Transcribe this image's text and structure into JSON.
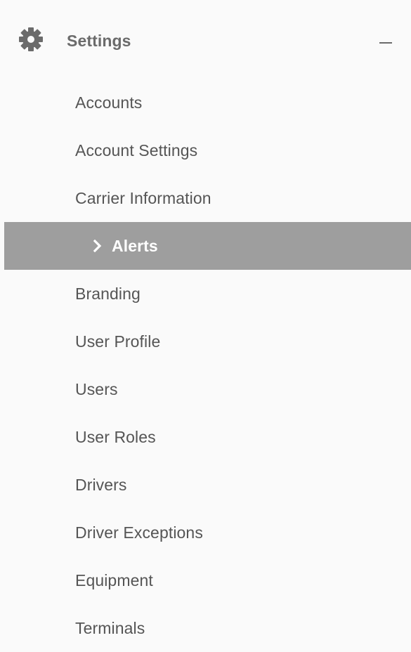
{
  "colors": {
    "background": "#fafafa",
    "header_text": "#6b6b6b",
    "item_text": "#555555",
    "active_background": "#9e9e9e",
    "active_text": "#ffffff"
  },
  "header": {
    "icon": "gear-icon",
    "label": "Settings",
    "toggle_icon": "minus-icon"
  },
  "menu": {
    "items": [
      {
        "label": "Accounts"
      },
      {
        "label": "Account Settings"
      },
      {
        "label": "Carrier Information"
      },
      {
        "label": "Alerts",
        "active": true,
        "icon": "chevron-right-icon"
      },
      {
        "label": "Branding"
      },
      {
        "label": "User Profile"
      },
      {
        "label": "Users"
      },
      {
        "label": "User Roles"
      },
      {
        "label": "Drivers"
      },
      {
        "label": "Driver Exceptions"
      },
      {
        "label": "Equipment"
      },
      {
        "label": "Terminals"
      }
    ]
  }
}
